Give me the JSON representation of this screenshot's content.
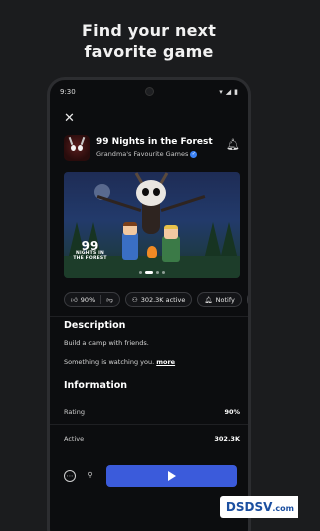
{
  "headline": [
    "Find your next",
    "favorite game"
  ],
  "status_bar": {
    "time": "9:30"
  },
  "game": {
    "title": "99 Nights in the Forest",
    "creator": "Grandma's Favourite Games",
    "logo_text_big": "99",
    "logo_text_small": "NIGHTS IN THE FOREST"
  },
  "chips": {
    "likes": "90%",
    "active": "302.3K active",
    "notify": "Notify"
  },
  "description": {
    "title": "Description",
    "line1": "Build a camp with friends.",
    "line2": "Something is watching you.",
    "more": "more"
  },
  "information": {
    "title": "Information",
    "rows": [
      {
        "key": "Rating",
        "value": "90%"
      },
      {
        "key": "Active",
        "value": "302.3K"
      }
    ]
  },
  "watermark": {
    "text": "DSDSV",
    "suffix": ".com"
  },
  "colors": {
    "accent": "#3b5bdb",
    "background": "#1b1c1e",
    "screen": "#0c0d0f"
  },
  "icons": [
    "close-icon",
    "bell-icon",
    "verified-badge-icon",
    "thumbs-up-icon",
    "thumbs-down-icon",
    "people-icon",
    "notify-bell-icon",
    "bookmark-icon",
    "more-options-icon",
    "add-friend-icon",
    "play-icon"
  ]
}
